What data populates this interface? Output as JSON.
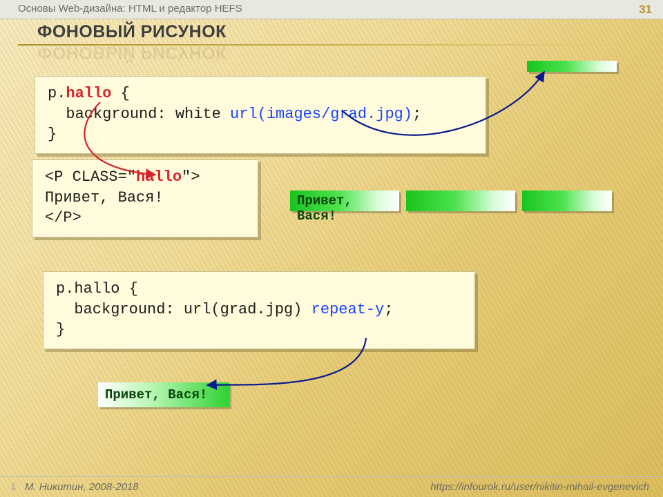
{
  "context_title": "Основы Web-дизайна: HTML и редактор HEFS",
  "page_number": "31",
  "heading": "ФОНОВЫЙ РИСУНОК",
  "code1": {
    "sel_p": "p",
    "sel_dot": ".",
    "sel_class": "hallo",
    "open": " {",
    "line2_a": "  background: white ",
    "line2_b": "url(images/grad.jpg)",
    "line2_c": ";",
    "close": "}"
  },
  "html_snippet": {
    "open_a": "<P CLASS=\"",
    "open_b": "hallo",
    "open_c": "\">",
    "text": "Привет, Вася!",
    "close": "</P>"
  },
  "code2": {
    "line1": "p.hallo {",
    "line2_a": "  background: url(grad.jpg) ",
    "line2_b": "repeat-y",
    "line2_c": ";",
    "close": "}"
  },
  "demo_text": "Привет, Вася!",
  "footer_author": "М. Никитин, 2008-2018",
  "footer_url": "https://infourok.ru/user/nikitin-mihail-evgenevich"
}
